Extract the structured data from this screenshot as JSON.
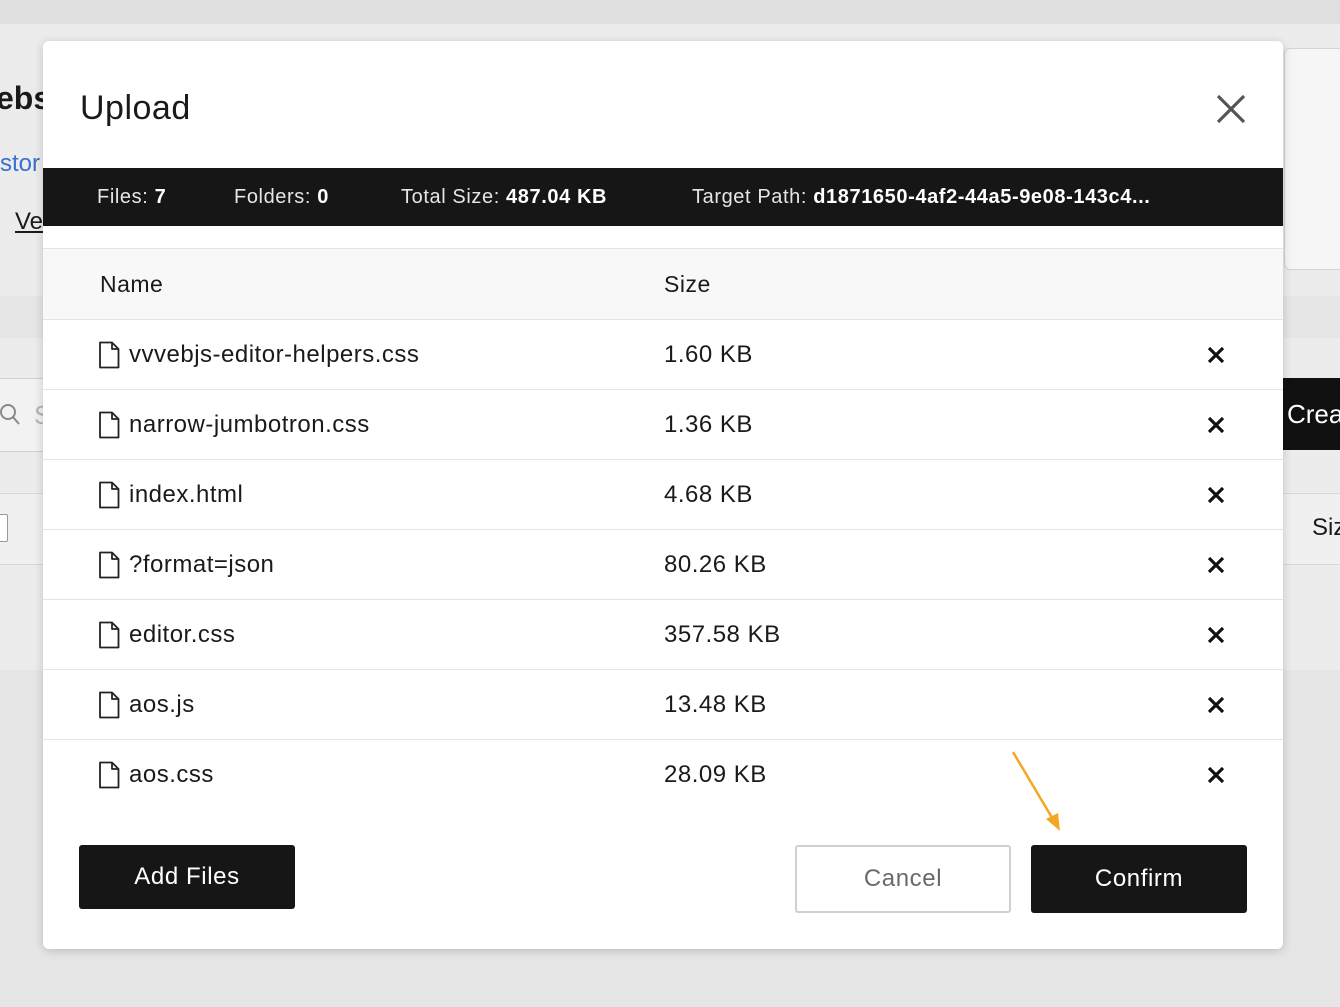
{
  "background": {
    "title_fragment": "ebs",
    "link_fragment": "stor",
    "link2_fragment": "Ve",
    "search_placeholder_fragment": "S",
    "create_button_fragment": "Crea",
    "size_header_fragment": "Siz"
  },
  "modal": {
    "title": "Upload",
    "info": {
      "files_label": "Files:",
      "files_value": "7",
      "folders_label": "Folders:",
      "folders_value": "0",
      "size_label": "Total Size:",
      "size_value": "487.04 KB",
      "path_label": "Target Path:",
      "path_value": "d1871650-4af2-44a5-9e08-143c4..."
    },
    "table": {
      "headers": {
        "name": "Name",
        "size": "Size"
      },
      "rows": [
        {
          "name": "vvvebjs-editor-helpers.css",
          "size": "1.60 KB"
        },
        {
          "name": "narrow-jumbotron.css",
          "size": "1.36 KB"
        },
        {
          "name": "index.html",
          "size": "4.68 KB"
        },
        {
          "name": "?format=json",
          "size": "80.26 KB"
        },
        {
          "name": "editor.css",
          "size": "357.58 KB"
        },
        {
          "name": "aos.js",
          "size": "13.48 KB"
        },
        {
          "name": "aos.css",
          "size": "28.09 KB"
        }
      ]
    },
    "buttons": {
      "add_files": "Add Files",
      "cancel": "Cancel",
      "confirm": "Confirm"
    }
  },
  "colors": {
    "dark": "#161616",
    "annotation_arrow": "#f5a623",
    "link": "#3b6fd0"
  },
  "icons": [
    "close-icon",
    "file-icon",
    "remove-icon",
    "search-icon"
  ]
}
